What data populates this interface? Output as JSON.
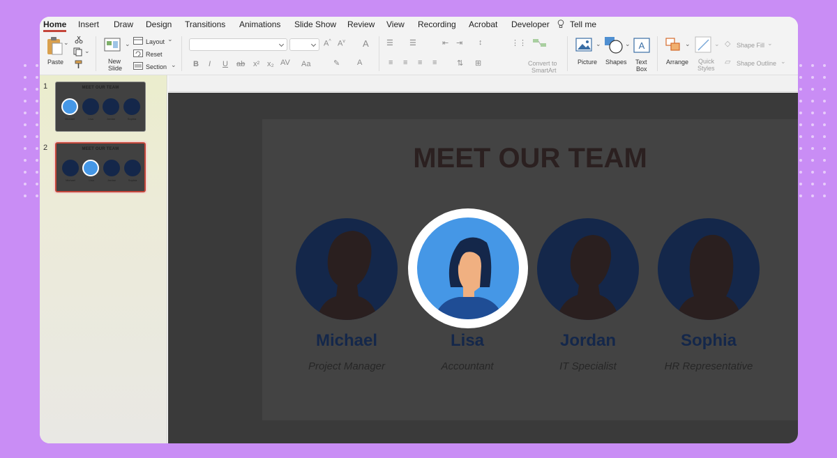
{
  "ribbon_tabs": [
    "Home",
    "Insert",
    "Draw",
    "Design",
    "Transitions",
    "Animations",
    "Slide Show",
    "Review",
    "View",
    "Recording",
    "Acrobat",
    "Developer",
    "Tell me"
  ],
  "ribbon": {
    "paste": "Paste",
    "new_slide_1": "New",
    "new_slide_2": "Slide",
    "layout": "Layout",
    "reset": "Reset",
    "section": "Section",
    "convert_1": "Convert to",
    "convert_2": "SmartArt",
    "picture": "Picture",
    "shapes": "Shapes",
    "textbox_1": "Text",
    "textbox_2": "Box",
    "arrange": "Arrange",
    "quick_styles_1": "Quick",
    "quick_styles_2": "Styles",
    "shape_fill": "Shape Fill",
    "shape_outline": "Shape Outline"
  },
  "thumbnails": [
    {
      "number": "1",
      "title": "MEET OUR TEAM",
      "active_index": 0
    },
    {
      "number": "2",
      "title": "MEET OUR TEAM",
      "active_index": 1
    }
  ],
  "slide": {
    "title": "MEET OUR TEAM",
    "members": [
      {
        "name": "Michael",
        "role": "Project Manager"
      },
      {
        "name": "Lisa",
        "role": "Accountant"
      },
      {
        "name": "Jordan",
        "role": "IT Specialist"
      },
      {
        "name": "Sophia",
        "role": "HR Representative"
      }
    ]
  },
  "colors": {
    "background": "#c98df5",
    "accent_red": "#c4463a",
    "navy": "#14274a",
    "highlight_blue": "#4597e6",
    "slide_bg": "#434343"
  }
}
